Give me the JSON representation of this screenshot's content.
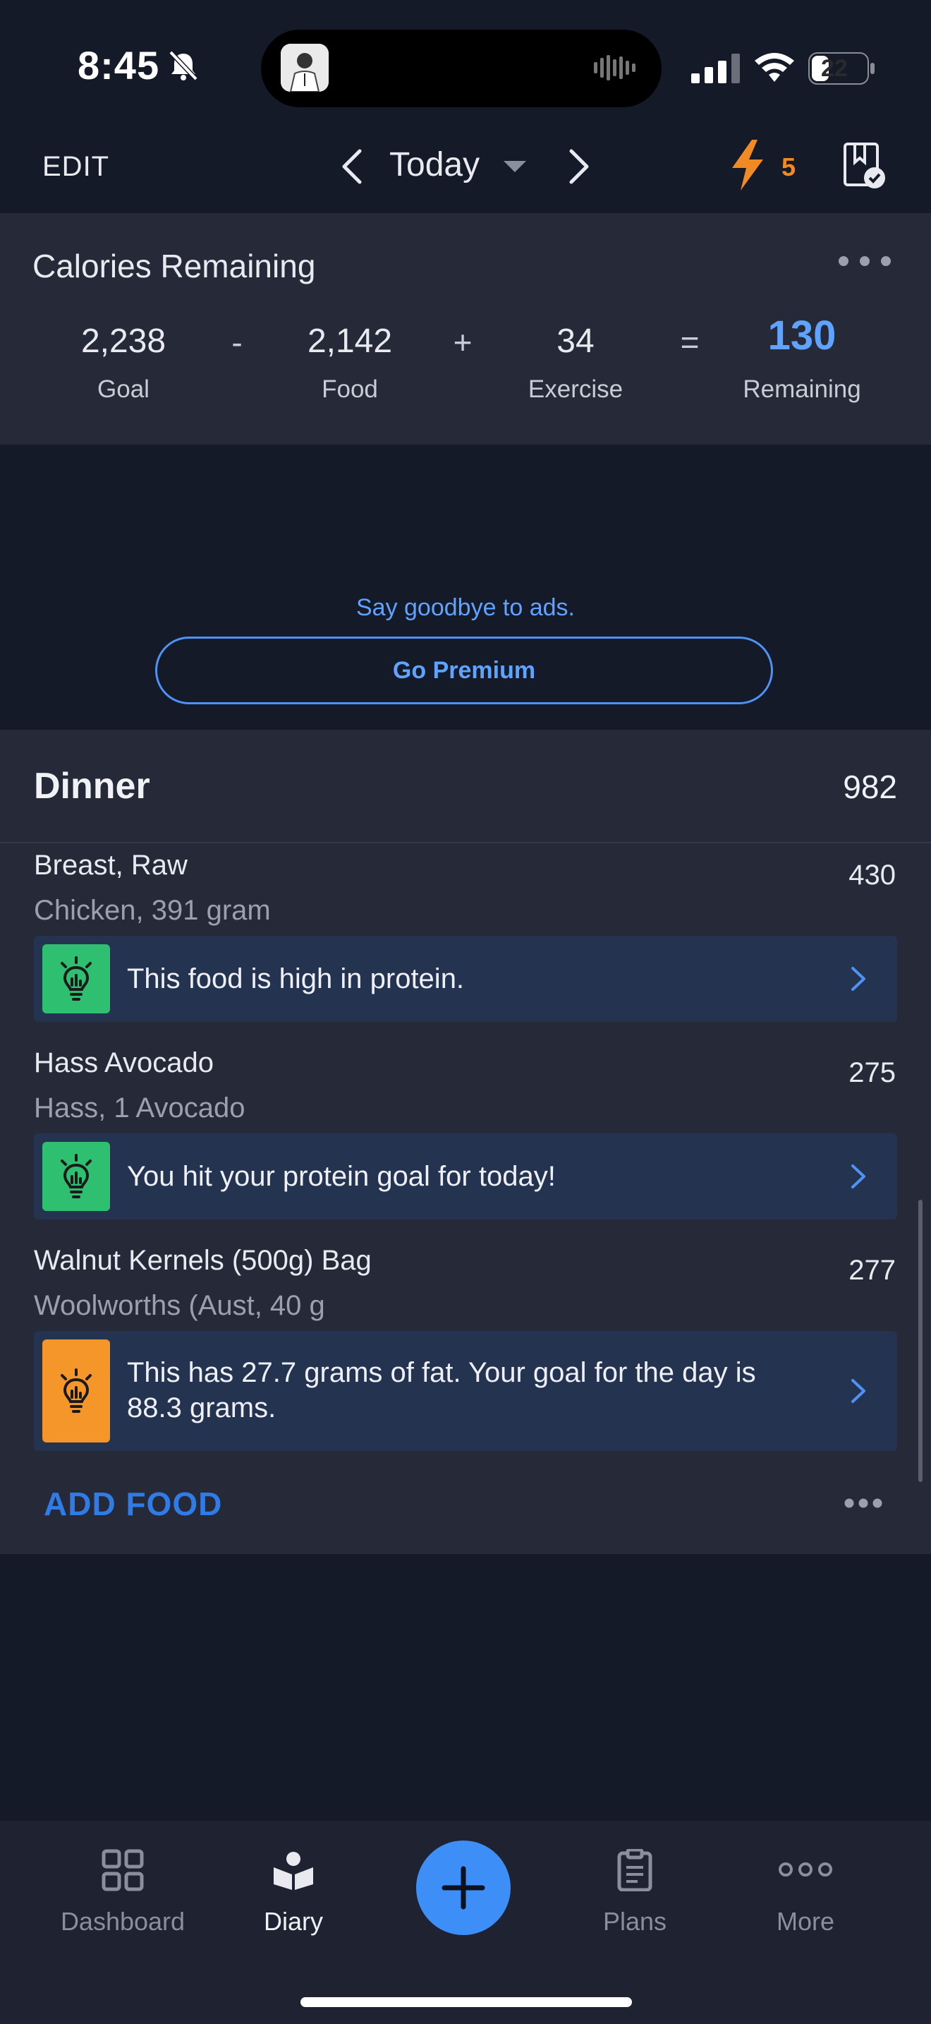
{
  "status_bar": {
    "time": "8:45",
    "battery": "22"
  },
  "header": {
    "edit_label": "EDIT",
    "date_label": "Today",
    "streak_count": "5"
  },
  "calories": {
    "title": "Calories Remaining",
    "goal_value": "2,238",
    "goal_label": "Goal",
    "op_minus": "-",
    "food_value": "2,142",
    "food_label": "Food",
    "op_plus": "+",
    "exercise_value": "34",
    "exercise_label": "Exercise",
    "op_equals": "=",
    "remaining_value": "130",
    "remaining_label": "Remaining"
  },
  "ad": {
    "text": "Say goodbye to ads.",
    "button_label": "Go Premium"
  },
  "meal": {
    "title": "Dinner",
    "calories": "982",
    "items": [
      {
        "name": "Breast, Raw",
        "description": "Chicken, 391 gram",
        "calories": "430",
        "insight": "This food is high in protein.",
        "insight_color": "#2fbf71"
      },
      {
        "name": "Hass Avocado",
        "description": "Hass, 1 Avocado",
        "calories": "275",
        "insight": "You hit your protein goal for today!",
        "insight_color": "#2fbf71"
      },
      {
        "name": "Walnut Kernels (500g) Bag",
        "description": "Woolworths (Aust, 40 g",
        "calories": "277",
        "insight_line1": "This has 27.7 grams of fat. Your goal for the day is",
        "insight_line2": "88.3 grams.",
        "insight_color": "#f5962a"
      }
    ],
    "add_food_label": "ADD FOOD"
  },
  "tabs": [
    {
      "label": "Dashboard",
      "icon": "dashboard-grid-icon",
      "active": false
    },
    {
      "label": "Diary",
      "icon": "diary-book-icon",
      "active": true
    },
    {
      "label": "Plans",
      "icon": "clipboard-icon",
      "active": false
    },
    {
      "label": "More",
      "icon": "more-dots-icon",
      "active": false
    }
  ],
  "colors": {
    "accent": "#3d8ef6",
    "streak": "#f08a24",
    "background": "#151a28",
    "card": "#262a38"
  }
}
